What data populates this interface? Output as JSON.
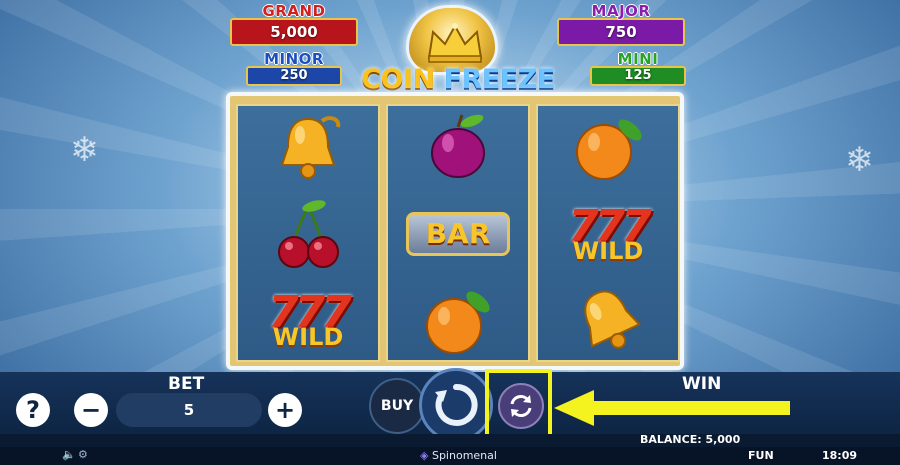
{
  "jackpots": {
    "grand": {
      "label": "GRAND",
      "value": "5,000",
      "label_color": "#d41f1f",
      "box_color": "#b8141c"
    },
    "major": {
      "label": "MAJOR",
      "value": "750",
      "label_color": "#8a1fae",
      "box_color": "#7b1aa6"
    },
    "minor": {
      "label": "MINOR",
      "value": "250",
      "label_color": "#1f4fbf",
      "box_color": "#1c47a8"
    },
    "mini": {
      "label": "MINI",
      "value": "125",
      "label_color": "#2aa32a",
      "box_color": "#1f8d24"
    }
  },
  "logo": {
    "word1": "COIN",
    "word2": "FREEZE"
  },
  "reels": [
    [
      "bell",
      "cherry",
      "wild"
    ],
    [
      "plum",
      "bar",
      "orange"
    ],
    [
      "orange",
      "wild",
      "bell"
    ]
  ],
  "symbols": {
    "bar_text": "BAR",
    "wild_sevens": "777",
    "wild_text": "WILD"
  },
  "controls": {
    "help_label": "?",
    "bet_label": "BET",
    "bet_value": "5",
    "minus_label": "−",
    "plus_label": "+",
    "buy_label": "BUY",
    "win_label": "WIN",
    "win_value": ""
  },
  "status": {
    "balance_label": "BALANCE: 5,000",
    "brand": "Spinomenal",
    "mode": "FUN",
    "time": "18:09"
  },
  "colors": {
    "highlight": "#f4f21f",
    "accent_gold": "#e7c44a"
  },
  "icons": [
    "snowflake-icon",
    "crown-icon",
    "spin-icon",
    "autoplay-icon",
    "sound-icon",
    "settings-icon",
    "arrow-icon"
  ]
}
